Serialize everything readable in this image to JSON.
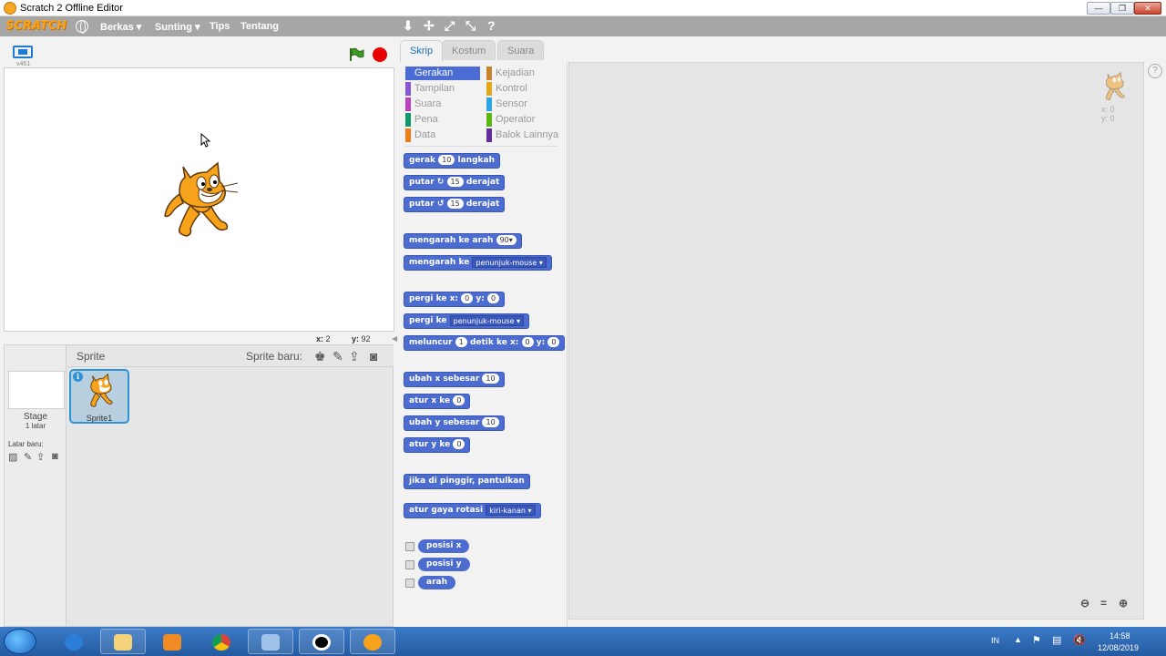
{
  "window": {
    "title": "Scratch 2 Offline Editor",
    "min": "—",
    "max": "❐",
    "close": "✕"
  },
  "menubar": {
    "logo": "SCRATCH",
    "items": [
      "Berkas ▾",
      "Sunting ▾",
      "Tips",
      "Tentang"
    ],
    "tools": [
      "⬇",
      "✢",
      "⤢",
      "⤡",
      "?"
    ]
  },
  "stage": {
    "version": "v461",
    "mouse_x_label": "x:",
    "mouse_x": "2",
    "mouse_y_label": "y:",
    "mouse_y": "92"
  },
  "sprites": {
    "title": "Sprite",
    "new_sprite_label": "Sprite baru:",
    "stage_label": "Stage",
    "stage_sub": "1 latar",
    "backdrop_label": "Latar baru:",
    "sprite_name": "Sprite1",
    "info": "i"
  },
  "tabs": [
    "Skrip",
    "Kostum",
    "Suara"
  ],
  "categories": [
    {
      "label": "Gerakan",
      "color": "#4a6cd4"
    },
    {
      "label": "Kejadian",
      "color": "#c88330"
    },
    {
      "label": "Tampilan",
      "color": "#8a55d7"
    },
    {
      "label": "Kontrol",
      "color": "#e1a91a"
    },
    {
      "label": "Suara",
      "color": "#bb42c3"
    },
    {
      "label": "Sensor",
      "color": "#2ca5e2"
    },
    {
      "label": "Pena",
      "color": "#0e9a6c"
    },
    {
      "label": "Operator",
      "color": "#5cb712"
    },
    {
      "label": "Data",
      "color": "#ee7d16"
    },
    {
      "label": "Balok Lainnya",
      "color": "#632d99"
    }
  ],
  "blocks": {
    "move": [
      "gerak",
      "10",
      "langkah"
    ],
    "turn_cw": [
      "putar",
      "↻",
      "15",
      "derajat"
    ],
    "turn_ccw": [
      "putar",
      "↺",
      "15",
      "derajat"
    ],
    "point_dir": [
      "mengarah ke arah",
      "90▾"
    ],
    "point_towards": [
      "mengarah ke",
      "penunjuk-mouse ▾"
    ],
    "goto_xy": [
      "pergi ke x:",
      "0",
      "y:",
      "0"
    ],
    "goto": [
      "pergi ke",
      "penunjuk-mouse ▾"
    ],
    "glide": [
      "meluncur",
      "1",
      "detik ke x:",
      "0",
      "y:",
      "0"
    ],
    "change_x": [
      "ubah x sebesar",
      "10"
    ],
    "set_x": [
      "atur x ke",
      "0"
    ],
    "change_y": [
      "ubah y sebesar",
      "10"
    ],
    "set_y": [
      "atur y ke",
      "0"
    ],
    "bounce": "jika di pinggir, pantulkan",
    "rotation": [
      "atur gaya rotasi",
      "kiri-kanan ▾"
    ],
    "reporters": [
      "posisi x",
      "posisi y",
      "arah"
    ]
  },
  "scripts_area": {
    "sprite_x": "x: 0",
    "sprite_y": "y: 0",
    "help": "?",
    "zoom_out": "🔍−",
    "zoom_reset": "=",
    "zoom_in": "🔍+"
  },
  "taskbar": {
    "lang": "IN",
    "time": "14:58",
    "date": "12/08/2019"
  }
}
